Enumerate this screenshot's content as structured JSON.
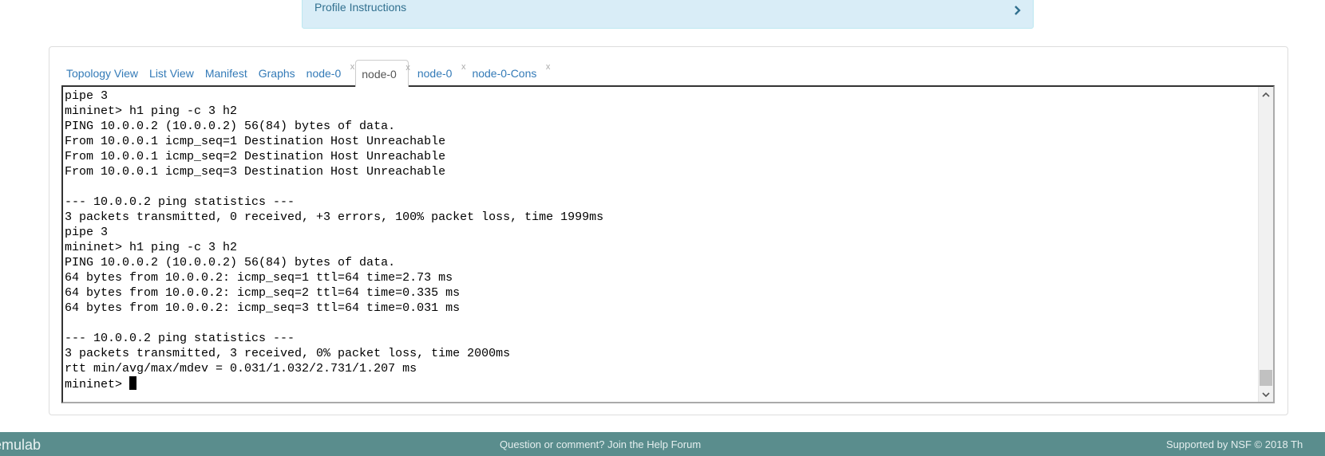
{
  "profile": {
    "title": "Profile Instructions",
    "icon": "chevron-right-icon"
  },
  "tabs": [
    {
      "label": "Topology View",
      "closable": false,
      "active": false
    },
    {
      "label": "List View",
      "closable": false,
      "active": false
    },
    {
      "label": "Manifest",
      "closable": false,
      "active": false
    },
    {
      "label": "Graphs",
      "closable": false,
      "active": false
    },
    {
      "label": "node-0",
      "closable": true,
      "active": false
    },
    {
      "label": "node-0",
      "closable": true,
      "active": true
    },
    {
      "label": "node-0",
      "closable": true,
      "active": false
    },
    {
      "label": "node-0-Cons",
      "closable": true,
      "active": false
    }
  ],
  "close_glyph": "x",
  "terminal": {
    "lines": [
      "pipe 3",
      "mininet> h1 ping -c 3 h2",
      "PING 10.0.0.2 (10.0.0.2) 56(84) bytes of data.",
      "From 10.0.0.1 icmp_seq=1 Destination Host Unreachable",
      "From 10.0.0.1 icmp_seq=2 Destination Host Unreachable",
      "From 10.0.0.1 icmp_seq=3 Destination Host Unreachable",
      "",
      "--- 10.0.0.2 ping statistics ---",
      "3 packets transmitted, 0 received, +3 errors, 100% packet loss, time 1999ms",
      "pipe 3",
      "mininet> h1 ping -c 3 h2",
      "PING 10.0.0.2 (10.0.0.2) 56(84) bytes of data.",
      "64 bytes from 10.0.0.2: icmp_seq=1 ttl=64 time=2.73 ms",
      "64 bytes from 10.0.0.2: icmp_seq=2 ttl=64 time=0.335 ms",
      "64 bytes from 10.0.0.2: icmp_seq=3 ttl=64 time=0.031 ms",
      "",
      "--- 10.0.0.2 ping statistics ---",
      "3 packets transmitted, 3 received, 0% packet loss, time 2000ms",
      "rtt min/avg/max/mdev = 0.031/1.032/2.731/1.207 ms"
    ],
    "prompt": "mininet> ",
    "scroll_position": 1.0
  },
  "footer": {
    "brand": "emulab",
    "middle": "Question or comment? Join the Help Forum",
    "right": "Supported by NSF   © 2018 Th"
  },
  "colors": {
    "link": "#337ab7",
    "info_bg": "#d9edf7",
    "footer_bg": "#5a8d8d"
  }
}
